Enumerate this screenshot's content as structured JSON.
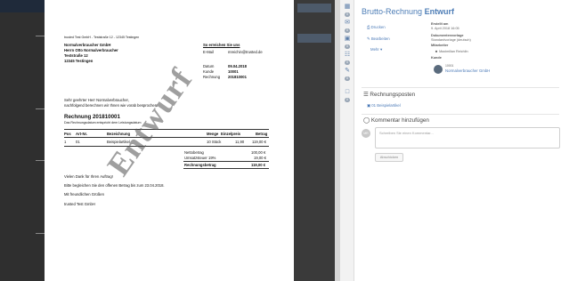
{
  "document": {
    "sender_line": "trusted Test GmbH - Teststraße 12 - 12345 Testingen",
    "recipient": [
      "Normalverbraucher GmbH",
      "Herrn Otto Normalverbraucher",
      "Teststraße 12",
      "12345 Testingen"
    ],
    "contact_heading": "So erreichen Sie uns",
    "email_label": "E-Mail",
    "email_value": "mreichin@trusted.de",
    "date_label": "Datum",
    "date_value": "09.04.2018",
    "customer_label": "Kunde",
    "customer_value": "10001",
    "invoice_label": "Rechnung",
    "invoice_value": "201810001",
    "salutation": "Sehr geehrter Herr Normalverbraucher,",
    "intro": "nachfolgend berechnen wir Ihnen wie vorab besprochen:",
    "heading": "Rechnung 201810001",
    "subheading": "Das Rechnungsdatum entspricht dem Leistungsdatum",
    "table_headers": [
      "Pos",
      "Art-Nr.",
      "Bezeichnung",
      "Menge",
      "Einzelpreis",
      "Betrag"
    ],
    "table_rows": [
      [
        "1",
        "01",
        "Beispielartikel",
        "10 Stück",
        "11,90",
        "119,00 €"
      ]
    ],
    "net_label": "Nettobetrag",
    "net_value": "100,00 €",
    "vat_label": "Umsatzsteuer 19%",
    "vat_value": "19,00 €",
    "total_label": "Rechnungsbetrag",
    "total_value": "119,00 €",
    "thanks": "Vielen Dank für Ihren Auftrag!",
    "payment": "Bitte begleichen Sie den offenen Betrag bis zum 23.04.2018.",
    "regards": "Mit freundlichen Grüßen",
    "company": "trusted Test GmbH",
    "watermark": "Entwurf"
  },
  "panel": {
    "title_prefix": "Brutto-Rechnung",
    "title_status": "Entwurf",
    "actions": [
      "Drucken",
      "Bearbeiten",
      "Mehr"
    ],
    "created_label": "Erstellt am",
    "created_value": "9. April 2018 16:05",
    "template_label": "Dokumentenvorlage",
    "template_value": "Standardvorlage (deutsch)",
    "staff_label": "Mitarbeiter",
    "staff_value": "Maximilian Reichlin",
    "customer_label": "Kunde",
    "customer_id": "10001",
    "customer_name": "Normalverbraucher GmbH",
    "positions_title": "Rechnungsposten",
    "positions_link": "01 Beispielartikel",
    "comment_title": "Kommentar hinzufügen",
    "comment_placeholder": "Schreiben Sie einen Kommentar...",
    "comment_button": "Abschicken",
    "avatar_initials": "MR"
  },
  "iconbar": {
    "badges": [
      "0",
      "0",
      "0",
      "0",
      "0",
      "0"
    ]
  },
  "colors": {
    "accent": "#4d7db6",
    "link": "#4a79b7"
  }
}
